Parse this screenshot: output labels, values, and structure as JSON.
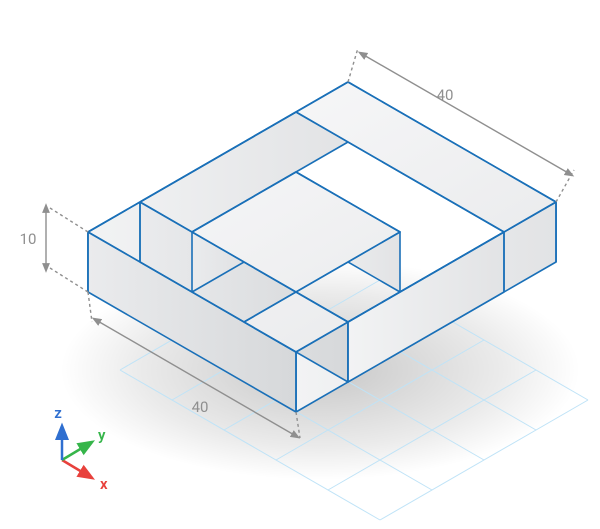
{
  "dimensions": {
    "top_width": "40",
    "bottom_width": "40",
    "height": "10"
  },
  "axes": {
    "x": {
      "label": "x",
      "color": "#e8413c"
    },
    "y": {
      "label": "y",
      "color": "#36b54a"
    },
    "z": {
      "label": "z",
      "color": "#2f6fd0"
    }
  },
  "colors": {
    "edge": "#1a70b8",
    "grid": "#bfe3f7",
    "dim": "#8f8f8f",
    "face_light": "#f4f5f6",
    "face_mid": "#e5e6e8",
    "face_dark": "#d8dadc"
  },
  "geometry_note": "Isometric illusion: square frame 40×40, wall height 10, inner notch creates impossible-object spiral."
}
